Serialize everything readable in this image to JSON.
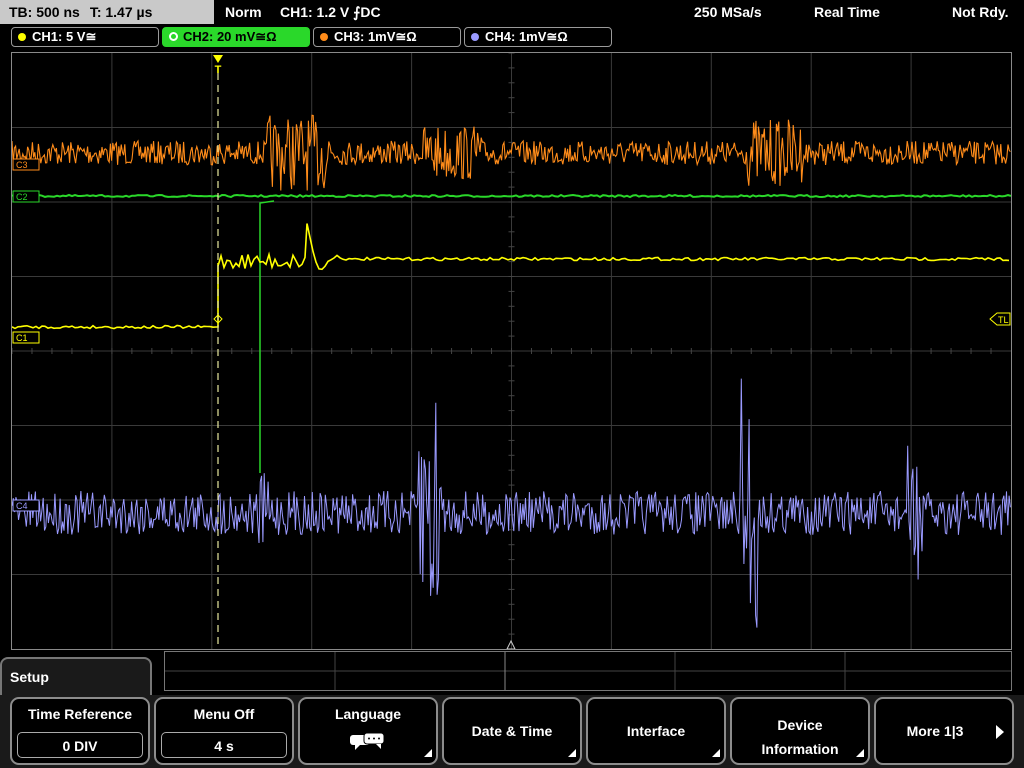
{
  "status": {
    "timebase": "TB: 500 ns",
    "trigger_time": "T: 1.47 µs",
    "mode": "Norm",
    "trigger_info": "CH1: 1.2 V ⨍DC",
    "sample_rate": "250 MSa/s",
    "acq_mode": "Real Time",
    "ready": "Not Rdy."
  },
  "channels": [
    {
      "label": "CH1: 5 V≅",
      "color": "#ffff00"
    },
    {
      "label": "CH2: 20 mV≅Ω",
      "color": "#2ad82a"
    },
    {
      "label": "CH3: 1mV≅Ω",
      "color": "#ff8c1a"
    },
    {
      "label": "CH4: 1mV≅Ω",
      "color": "#9a9aff"
    }
  ],
  "markers": {
    "c3": "C3",
    "c2": "C2",
    "c1": "C1",
    "c4": "C4",
    "tl": "TL",
    "trig": "T"
  },
  "menu": {
    "title": "Setup",
    "softkeys": [
      {
        "label": "Time Reference",
        "value": "0 DIV"
      },
      {
        "label": "Menu Off",
        "value": "4 s"
      },
      {
        "label": "Language",
        "icon": "speech-bubbles-icon"
      },
      {
        "label": "Date & Time"
      },
      {
        "label": "Interface"
      },
      {
        "label1": "Device",
        "label2": "Information"
      },
      {
        "label": "More 1|3"
      }
    ]
  }
}
